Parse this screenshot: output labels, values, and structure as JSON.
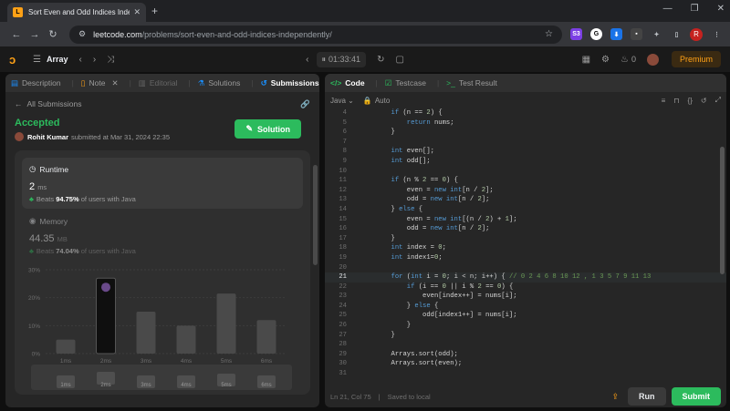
{
  "browser": {
    "tab_title": "Sort Even and Odd Indices Inde",
    "url_host": "leetcode.com",
    "url_path": "/problems/sort-even-and-odd-indices-independently/",
    "profile_initial": "R"
  },
  "nav": {
    "problem_list": "Array",
    "timer": "01:33:41",
    "streak": "0",
    "premium": "Premium"
  },
  "left_tabs": [
    "Description",
    "Note",
    "Editorial",
    "Solutions",
    "Submissions"
  ],
  "submission": {
    "back_label": "All Submissions",
    "status": "Accepted",
    "user": "Rohit Kumar",
    "submitted_text": "submitted at Mar 31, 2024 22:35",
    "solution_button": "Solution",
    "runtime_title": "Runtime",
    "runtime_value": "2",
    "runtime_unit": "ms",
    "runtime_beats_prefix": "Beats",
    "runtime_beats": "94.75%",
    "runtime_beats_suffix": "of users with Java",
    "memory_title": "Memory",
    "memory_value": "44.35",
    "memory_unit": "MB",
    "memory_beats_prefix": "Beats",
    "memory_beats": "74.04%",
    "memory_beats_suffix": "of users with Java"
  },
  "chart_data": {
    "type": "bar",
    "categories": [
      "1ms",
      "2ms",
      "3ms",
      "4ms",
      "5ms",
      "6ms"
    ],
    "values": [
      5,
      27,
      15,
      10,
      21.5,
      12
    ],
    "highlight_index": 1,
    "y_ticks": [
      "30%",
      "20%",
      "10%",
      "0%"
    ],
    "ylim": [
      0,
      30
    ],
    "mini_labels": [
      "1ms",
      "2ms",
      "3ms",
      "4ms",
      "5ms",
      "6ms"
    ],
    "colors": {
      "bar": "#4a4a4a",
      "highlight": "#0f0f0f"
    }
  },
  "editor": {
    "tabs": [
      "Code",
      "Testcase",
      "Test Result"
    ],
    "language": "Java",
    "mode": "Auto",
    "cursor": "Ln 21, Col 75",
    "saved": "Saved to local",
    "run_label": "Run",
    "submit_label": "Submit"
  },
  "code_lines": [
    {
      "n": "4",
      "t": [
        [
          "tx",
          "        "
        ],
        [
          "kw",
          "if"
        ],
        [
          "tx",
          " (n == "
        ],
        [
          "nm",
          "2"
        ],
        [
          "tx",
          ") {"
        ]
      ]
    },
    {
      "n": "5",
      "t": [
        [
          "tx",
          "            "
        ],
        [
          "kw",
          "return"
        ],
        [
          "tx",
          " nums;"
        ]
      ]
    },
    {
      "n": "6",
      "t": [
        [
          "tx",
          "        }"
        ]
      ]
    },
    {
      "n": "7",
      "t": [
        [
          "tx",
          ""
        ]
      ]
    },
    {
      "n": "8",
      "t": [
        [
          "tx",
          "        "
        ],
        [
          "ty",
          "int"
        ],
        [
          "tx",
          " even[];"
        ]
      ]
    },
    {
      "n": "9",
      "t": [
        [
          "tx",
          "        "
        ],
        [
          "ty",
          "int"
        ],
        [
          "tx",
          " odd[];"
        ]
      ]
    },
    {
      "n": "10",
      "t": [
        [
          "tx",
          ""
        ]
      ]
    },
    {
      "n": "11",
      "t": [
        [
          "tx",
          "        "
        ],
        [
          "kw",
          "if"
        ],
        [
          "tx",
          " (n % "
        ],
        [
          "nm",
          "2"
        ],
        [
          "tx",
          " == "
        ],
        [
          "nm",
          "0"
        ],
        [
          "tx",
          ") {"
        ]
      ]
    },
    {
      "n": "12",
      "t": [
        [
          "tx",
          "            even = "
        ],
        [
          "kw",
          "new"
        ],
        [
          "tx",
          " "
        ],
        [
          "ty",
          "int"
        ],
        [
          "tx",
          "[n / "
        ],
        [
          "nm",
          "2"
        ],
        [
          "tx",
          "];"
        ]
      ]
    },
    {
      "n": "13",
      "t": [
        [
          "tx",
          "            odd = "
        ],
        [
          "kw",
          "new"
        ],
        [
          "tx",
          " "
        ],
        [
          "ty",
          "int"
        ],
        [
          "tx",
          "[n / "
        ],
        [
          "nm",
          "2"
        ],
        [
          "tx",
          "];"
        ]
      ]
    },
    {
      "n": "14",
      "t": [
        [
          "tx",
          "        } "
        ],
        [
          "kw",
          "else"
        ],
        [
          "tx",
          " {"
        ]
      ]
    },
    {
      "n": "15",
      "t": [
        [
          "tx",
          "            even = "
        ],
        [
          "kw",
          "new"
        ],
        [
          "tx",
          " "
        ],
        [
          "ty",
          "int"
        ],
        [
          "tx",
          "[(n / "
        ],
        [
          "nm",
          "2"
        ],
        [
          "tx",
          ") + "
        ],
        [
          "nm",
          "1"
        ],
        [
          "tx",
          "];"
        ]
      ]
    },
    {
      "n": "16",
      "t": [
        [
          "tx",
          "            odd = "
        ],
        [
          "kw",
          "new"
        ],
        [
          "tx",
          " "
        ],
        [
          "ty",
          "int"
        ],
        [
          "tx",
          "[n / "
        ],
        [
          "nm",
          "2"
        ],
        [
          "tx",
          "];"
        ]
      ]
    },
    {
      "n": "17",
      "t": [
        [
          "tx",
          "        }"
        ]
      ]
    },
    {
      "n": "18",
      "t": [
        [
          "tx",
          "        "
        ],
        [
          "ty",
          "int"
        ],
        [
          "tx",
          " index = "
        ],
        [
          "nm",
          "0"
        ],
        [
          "tx",
          ";"
        ]
      ]
    },
    {
      "n": "19",
      "t": [
        [
          "tx",
          "        "
        ],
        [
          "ty",
          "int"
        ],
        [
          "tx",
          " index1="
        ],
        [
          "nm",
          "0"
        ],
        [
          "tx",
          ";"
        ]
      ]
    },
    {
      "n": "20",
      "t": [
        [
          "tx",
          ""
        ]
      ]
    },
    {
      "n": "21",
      "t": [
        [
          "tx",
          "        "
        ],
        [
          "kw",
          "for"
        ],
        [
          "tx",
          " ("
        ],
        [
          "ty",
          "int"
        ],
        [
          "tx",
          " i = "
        ],
        [
          "nm",
          "0"
        ],
        [
          "tx",
          "; i < n; i++) { "
        ],
        [
          "cm",
          "// 0 2 4 6 8 10 12 , 1 3 5 7 9 11 13"
        ]
      ]
    },
    {
      "n": "22",
      "t": [
        [
          "tx",
          "            "
        ],
        [
          "kw",
          "if"
        ],
        [
          "tx",
          " (i == "
        ],
        [
          "nm",
          "0"
        ],
        [
          "tx",
          " || i % "
        ],
        [
          "nm",
          "2"
        ],
        [
          "tx",
          " == "
        ],
        [
          "nm",
          "0"
        ],
        [
          "tx",
          ") {"
        ]
      ]
    },
    {
      "n": "23",
      "t": [
        [
          "tx",
          "                even[index++] = nums[i];"
        ]
      ]
    },
    {
      "n": "24",
      "t": [
        [
          "tx",
          "            } "
        ],
        [
          "kw",
          "else"
        ],
        [
          "tx",
          " {"
        ]
      ]
    },
    {
      "n": "25",
      "t": [
        [
          "tx",
          "                odd[index1++] = nums[i];"
        ]
      ]
    },
    {
      "n": "26",
      "t": [
        [
          "tx",
          "            }"
        ]
      ]
    },
    {
      "n": "27",
      "t": [
        [
          "tx",
          "        }"
        ]
      ]
    },
    {
      "n": "28",
      "t": [
        [
          "tx",
          ""
        ]
      ]
    },
    {
      "n": "29",
      "t": [
        [
          "tx",
          "        Arrays.sort(odd);"
        ]
      ]
    },
    {
      "n": "30",
      "t": [
        [
          "tx",
          "        Arrays.sort(even);"
        ]
      ]
    },
    {
      "n": "31",
      "t": [
        [
          "tx",
          ""
        ]
      ]
    }
  ]
}
